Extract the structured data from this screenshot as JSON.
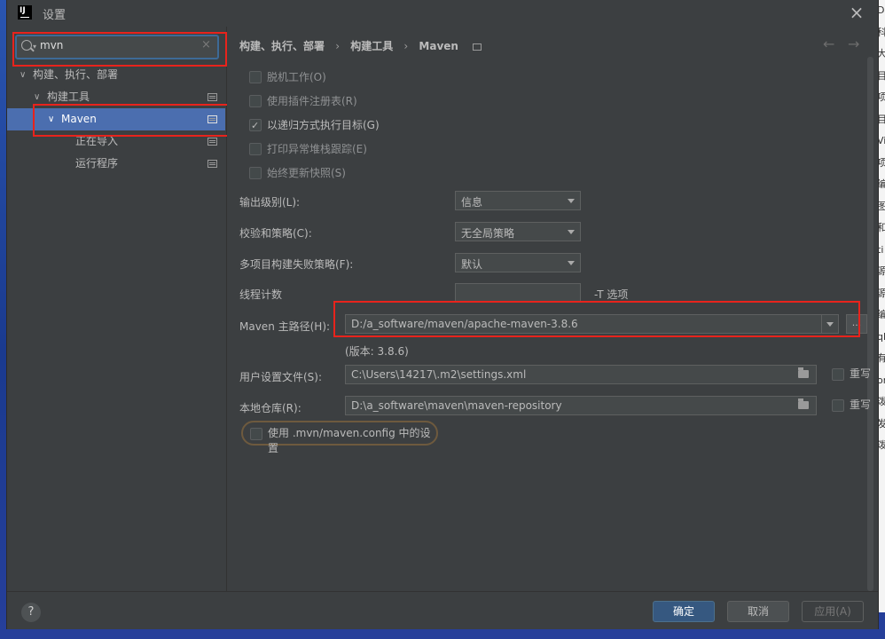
{
  "dialog": {
    "title": "设置"
  },
  "search": {
    "value": "mvn",
    "clear_icon": "×"
  },
  "tree": [
    {
      "label": "构建、执行、部署",
      "expanded": true
    },
    {
      "label": "构建工具",
      "expanded": true
    },
    {
      "label": "Maven",
      "expanded": true,
      "selected": true
    },
    {
      "label": "正在导入"
    },
    {
      "label": "运行程序"
    }
  ],
  "breadcrumb": {
    "items": [
      "构建、执行、部署",
      "构建工具",
      "Maven"
    ],
    "separator": "›"
  },
  "nav": {
    "back": "←",
    "forward": "→"
  },
  "checkboxes": [
    {
      "label": "脱机工作(O)",
      "checked": false
    },
    {
      "label": "使用插件注册表(R)",
      "checked": false
    },
    {
      "label": "以递归方式执行目标(G)",
      "checked": true
    },
    {
      "label": "打印异常堆栈跟踪(E)",
      "checked": false
    },
    {
      "label": "始终更新快照(S)",
      "checked": false
    }
  ],
  "fields": {
    "output_level": {
      "label": "输出级别(L):",
      "value": "信息"
    },
    "checksum_policy": {
      "label": "校验和策略(C):",
      "value": "无全局策略"
    },
    "multiproject_fail": {
      "label": "多项目构建失败策略(F):",
      "value": "默认"
    },
    "thread_count": {
      "label": "线程计数",
      "value": "",
      "suffix": "-T 选项"
    },
    "maven_home": {
      "label": "Maven 主路径(H):",
      "value": "D:/a_software/maven/apache-maven-3.8.6",
      "browse": "...",
      "version": "(版本: 3.8.6)"
    },
    "user_settings": {
      "label": "用户设置文件(S):",
      "value": "C:\\Users\\14217\\.m2\\settings.xml",
      "override": "重写"
    },
    "local_repo": {
      "label": "本地仓库(R):",
      "value": "D:\\a_software\\maven\\maven-repository",
      "override": "重写"
    }
  },
  "mvn_config": {
    "label": "使用 .mvn/maven.config 中的设置",
    "checked": false
  },
  "buttons": {
    "help": "?",
    "ok": "确定",
    "cancel": "取消",
    "apply": "应用(A)"
  },
  "bg_strip": [
    "D",
    "科",
    "大",
    "目",
    "项",
    "目",
    "Vi",
    "项",
    "编",
    "图",
    "和",
    "ti",
    "源",
    "源",
    "编",
    "ql",
    "有",
    "on",
    "泼",
    "发",
    "泼"
  ],
  "colors": {
    "selection": "#4b6eaf",
    "highlight_box": "#e8231c",
    "primary_button": "#365880"
  }
}
